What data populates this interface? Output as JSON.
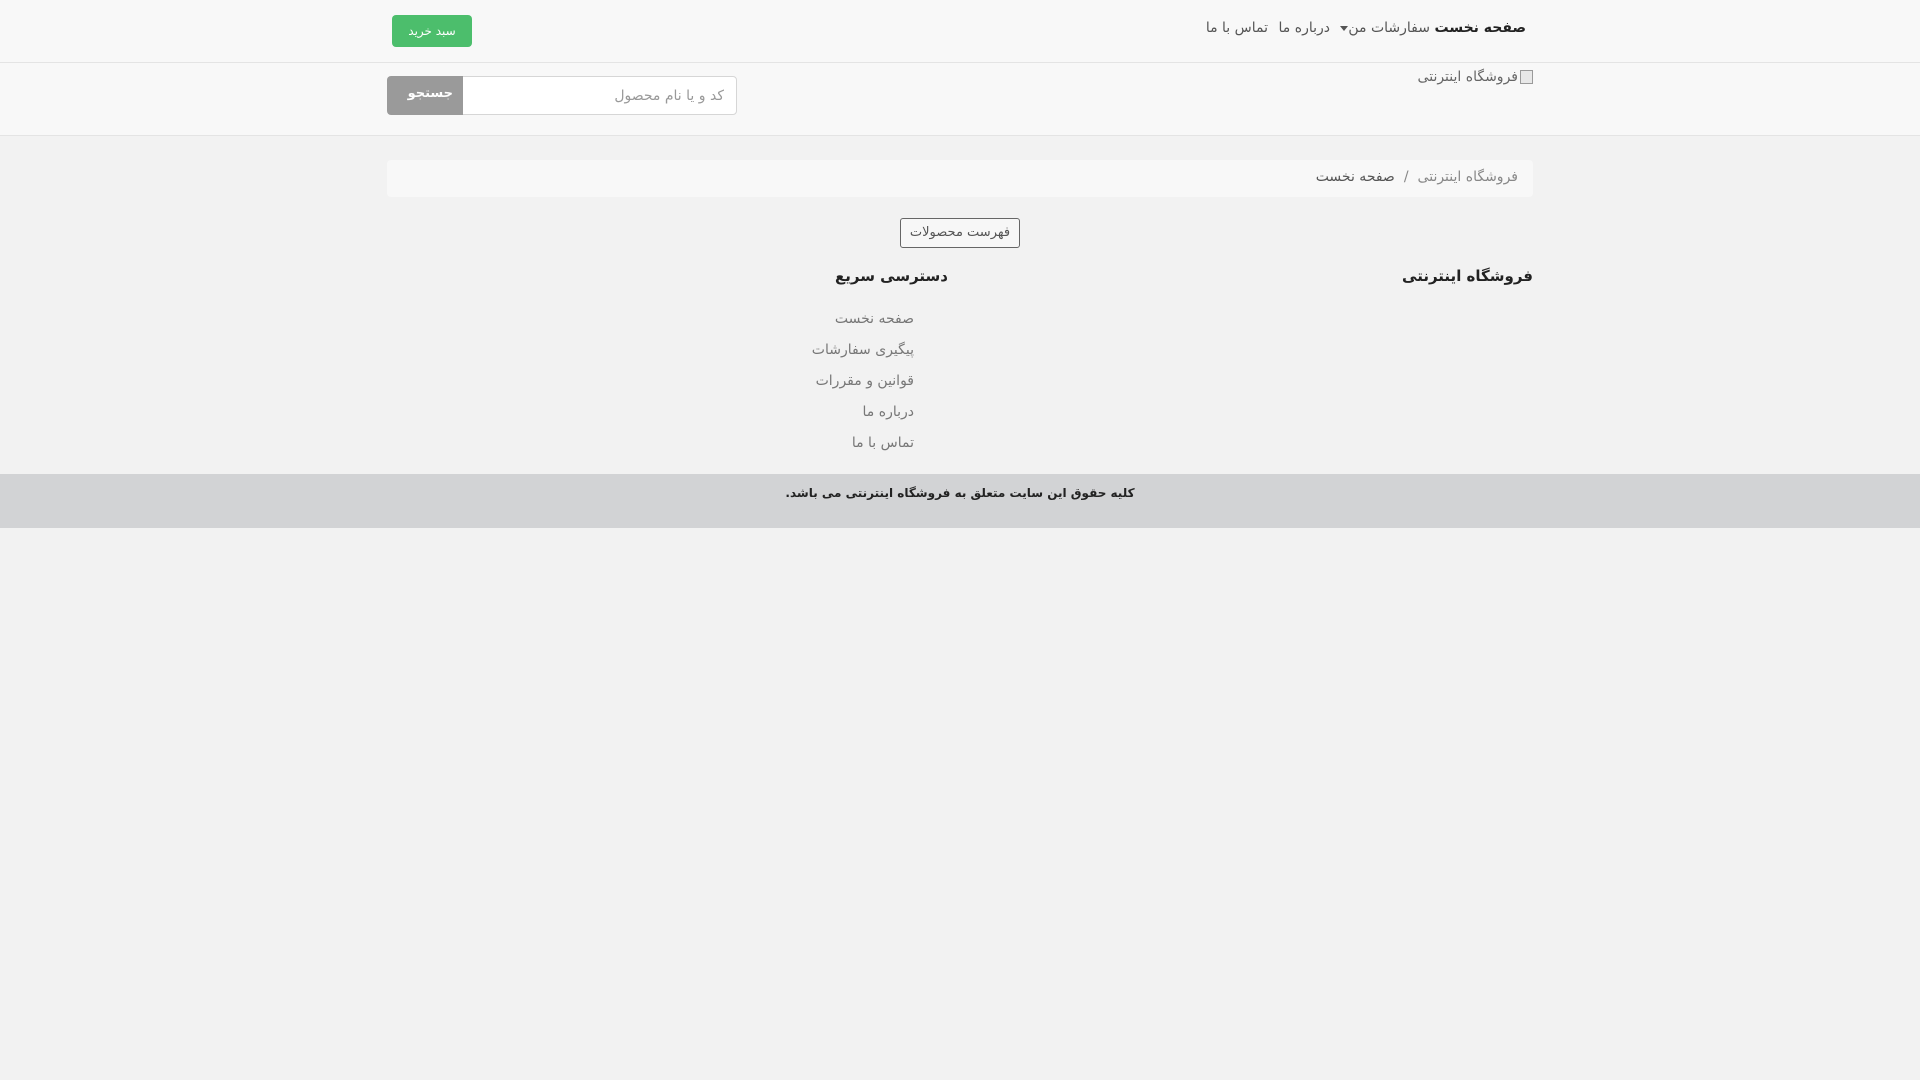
{
  "nav": {
    "items": [
      {
        "label": "صفحه نخست",
        "active": true
      },
      {
        "label": "سفارشات من",
        "dropdown": true
      },
      {
        "label": "درباره ما"
      },
      {
        "label": "تماس با ما"
      }
    ],
    "cart_label": "سبد خرید"
  },
  "header": {
    "logo_alt": "فروشگاه اینترنتی",
    "search": {
      "placeholder": "کد و یا نام محصول",
      "button_label": "جستجو"
    }
  },
  "breadcrumb": {
    "items": [
      "فروشگاه اینترنتی",
      "صفحه نخست"
    ],
    "separator": "/"
  },
  "products_button": "فهرست محصولات",
  "footer": {
    "store_title": "فروشگاه اینترنتی",
    "quick_access": {
      "title": "دسترسی سریع",
      "links": [
        "صفحه نخست",
        "پیگیری سفارشات",
        "قوانین و مقررات",
        "درباره ما",
        "تماس با ما"
      ]
    },
    "copyright": "کلیه حقوق این سایت متعلق به فروشگاه اینترنتی می باشد."
  },
  "colors": {
    "cart": "#4cbe6c",
    "search_button": "#9a9a9a",
    "copyright_bar": "#d2d3d5"
  }
}
